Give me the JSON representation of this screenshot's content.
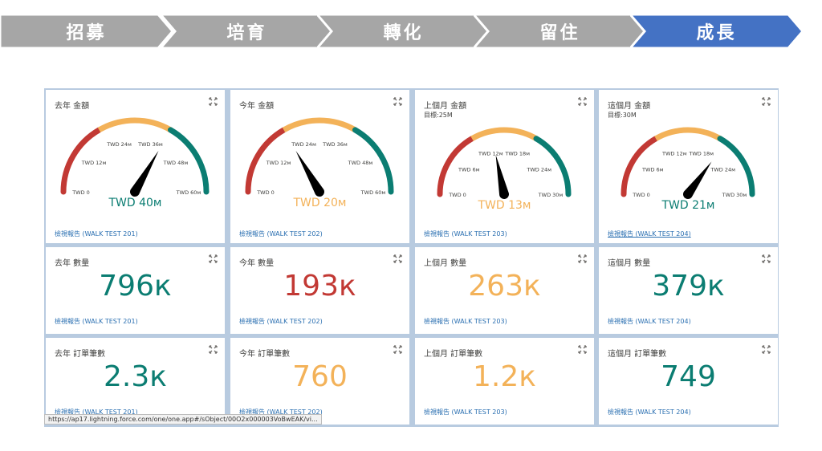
{
  "colors": {
    "stage_default": "#a6a6a6",
    "stage_active": "#4472c4",
    "gauge_red": "#c23934",
    "gauge_yellow": "#f3b259",
    "gauge_teal": "#0b7d72",
    "link": "#2a6fb1"
  },
  "stages": [
    {
      "label": "招募",
      "active": false
    },
    {
      "label": "培育",
      "active": false
    },
    {
      "label": "轉化",
      "active": false
    },
    {
      "label": "留住",
      "active": false
    },
    {
      "label": "成長",
      "active": true
    }
  ],
  "gauge_cards": [
    {
      "title": "去年 金額",
      "subtitle": "",
      "value": 40,
      "max": 60,
      "ticks": [
        "TWD 0",
        "TWD 12м",
        "TWD 24м",
        "TWD 36м",
        "TWD 48м",
        "TWD 60м"
      ],
      "value_label": "TWD 40м",
      "status": "teal",
      "link": "檢視報告 (WALK TEST 201)",
      "link_underline": false
    },
    {
      "title": "今年 金額",
      "subtitle": "",
      "value": 20,
      "max": 60,
      "ticks": [
        "TWD 0",
        "TWD 12м",
        "TWD 24м",
        "TWD 36м",
        "TWD 48м",
        "TWD 60м"
      ],
      "value_label": "TWD 20м",
      "status": "yellow",
      "link": "檢視報告 (WALK TEST 202)",
      "link_underline": false
    },
    {
      "title": "上個月 金額",
      "subtitle": "目標:25M",
      "value": 13,
      "max": 30,
      "ticks": [
        "TWD 0",
        "TWD 6м",
        "TWD 12м",
        "TWD 18м",
        "TWD 24м",
        "TWD 30м"
      ],
      "value_label": "TWD 13м",
      "status": "yellow",
      "link": "檢視報告 (WALK TEST 203)",
      "link_underline": false
    },
    {
      "title": "這個月 金額",
      "subtitle": "目標:30M",
      "value": 21,
      "max": 30,
      "ticks": [
        "TWD 0",
        "TWD 6м",
        "TWD 12м",
        "TWD 18м",
        "TWD 24м",
        "TWD 30м"
      ],
      "value_label": "TWD 21м",
      "status": "teal",
      "link": "檢視報告 (WALK TEST 204)",
      "link_underline": true
    }
  ],
  "qty_cards": [
    {
      "title": "去年 數量",
      "value": "796к",
      "status": "teal",
      "link": "檢視報告 (WALK TEST 201)"
    },
    {
      "title": "今年 數量",
      "value": "193к",
      "status": "red",
      "link": "檢視報告 (WALK TEST 202)"
    },
    {
      "title": "上個月 數量",
      "value": "263к",
      "status": "yellow",
      "link": "檢視報告 (WALK TEST 203)"
    },
    {
      "title": "這個月 數量",
      "value": "379к",
      "status": "teal",
      "link": "檢視報告 (WALK TEST 204)"
    }
  ],
  "order_cards": [
    {
      "title": "去年 訂單筆數",
      "value": "2.3к",
      "status": "teal",
      "link": "檢視報告 (WALK TEST 201)"
    },
    {
      "title": "今年 訂單筆數",
      "value": "760",
      "status": "yellow",
      "link": "檢視報告 (WALK TEST 202)"
    },
    {
      "title": "上個月 訂單筆數",
      "value": "1.2к",
      "status": "yellow",
      "link": "檢視報告 (WALK TEST 203)"
    },
    {
      "title": "這個月 訂單筆數",
      "value": "749",
      "status": "teal",
      "link": "檢視報告 (WALK TEST 204)"
    }
  ],
  "status_bar_url": "https://ap17.lightning.force.com/one/one.app#/sObject/00O2x000003VoBwEAK/vi..."
}
